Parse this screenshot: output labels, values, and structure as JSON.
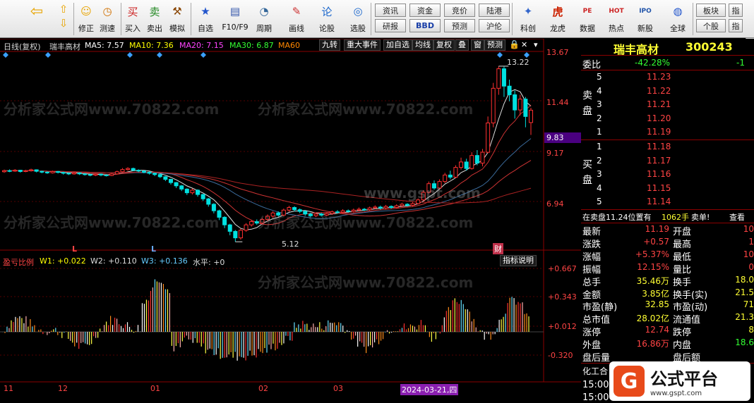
{
  "toolbar": {
    "items": [
      {
        "label": "",
        "icon": "back-arrow-icon"
      },
      {
        "label": "修正",
        "icon": "smile-icon"
      },
      {
        "label": "测速",
        "icon": "clock-icon"
      },
      {
        "label": "买入",
        "icon": "buy-icon"
      },
      {
        "label": "卖出",
        "icon": "sell-icon"
      },
      {
        "label": "模拟",
        "icon": "hammer-icon"
      },
      {
        "label": "自选",
        "icon": "star-icon"
      },
      {
        "label": "F10/F9",
        "icon": "window-icon"
      },
      {
        "label": "周期",
        "icon": "cycle-icon"
      },
      {
        "label": "画线",
        "icon": "pencil-icon"
      },
      {
        "label": "论股",
        "icon": "chat-icon"
      },
      {
        "label": "选股",
        "icon": "chart-search-icon"
      }
    ],
    "grid_buttons": [
      [
        "资讯",
        "资金",
        "竞价",
        "陆港"
      ],
      [
        "研报",
        "BBD",
        "预测",
        "沪伦"
      ]
    ],
    "right_items": [
      {
        "label": "科创",
        "icon": "science-icon"
      },
      {
        "label": "龙虎",
        "icon": "tiger-icon"
      },
      {
        "label": "数据",
        "icon": "pe-icon"
      },
      {
        "label": "热点",
        "icon": "hot-icon"
      },
      {
        "label": "新股",
        "icon": "ipo-icon"
      },
      {
        "label": "全球",
        "icon": "globe-icon"
      }
    ],
    "far_right": [
      [
        "板块",
        "个股"
      ],
      [
        "指",
        "指"
      ]
    ]
  },
  "chart_header": {
    "period": "日线(复权)",
    "name": "瑞丰高材",
    "ma5": "MA5: 7.57",
    "ma10": "MA10: 7.36",
    "ma20": "MA20: 7.15",
    "ma30": "MA30: 6.87",
    "ma60": "MA60",
    "buttons": [
      "九转",
      "重大事件",
      "加自选",
      "均线",
      "复权",
      "叠",
      "窗",
      "预测"
    ]
  },
  "price_axis": [
    "13.67",
    "11.44",
    "9.83",
    "9.17",
    "6.94"
  ],
  "annotations": {
    "high": "13.22",
    "low": "5.12",
    "event_tag": "财"
  },
  "l_markers": [
    "L",
    "L"
  ],
  "indicator": {
    "name": "盈亏比例",
    "w1": "W1: +0.022",
    "w2": "W2: +0.110",
    "w3": "W3: +0.136",
    "level": "水平: +0",
    "button": "指标说明",
    "axis": [
      "+0.667",
      "+0.343",
      "+0.012",
      "-0.320"
    ]
  },
  "date_axis": [
    "11",
    "12",
    "01",
    "02",
    "03"
  ],
  "date_highlight": "2024-03-21,四",
  "watermark": "分析家公式网www.70822.com",
  "watermark_center": "www.gspt.com",
  "quote": {
    "title": "瑞丰高材",
    "code": "300243",
    "weibi_label": "委比",
    "weibi_value": "-42.28%",
    "weibi_extra": "-1",
    "sell_label": "卖盘",
    "buy_label": "买盘",
    "sell": [
      {
        "lvl": "5",
        "price": "11.23"
      },
      {
        "lvl": "4",
        "price": "11.22"
      },
      {
        "lvl": "3",
        "price": "11.21"
      },
      {
        "lvl": "2",
        "price": "11.20"
      },
      {
        "lvl": "1",
        "price": "11.19"
      }
    ],
    "buy": [
      {
        "lvl": "1",
        "price": "11.18"
      },
      {
        "lvl": "2",
        "price": "11.17"
      },
      {
        "lvl": "3",
        "price": "11.16"
      },
      {
        "lvl": "4",
        "price": "11.15"
      },
      {
        "lvl": "5",
        "price": "11.14"
      }
    ],
    "info_line": {
      "text": "在卖盘11.24位置有",
      "vol": "1062手",
      "tag": "卖单!",
      "link": "查看"
    },
    "stats": [
      {
        "l": "最新",
        "v": "11.19",
        "l2": "开盘",
        "v2": "10"
      },
      {
        "l": "涨跌",
        "v": "+0.57",
        "l2": "最高",
        "v2": "1"
      },
      {
        "l": "涨幅",
        "v": "+5.37%",
        "l2": "最低",
        "v2": "10"
      },
      {
        "l": "振幅",
        "v": "12.15%",
        "l2": "量比",
        "v2": "0"
      },
      {
        "l": "总手",
        "v": "35.46万",
        "l2": "换手",
        "v2": "18.0"
      },
      {
        "l": "金额",
        "v": "3.85亿",
        "l2": "换手(实)",
        "v2": "21.5"
      },
      {
        "l": "市盈(静)",
        "v": "32.85",
        "l2": "市盈(动)",
        "v2": "71"
      },
      {
        "l": "总市值",
        "v": "28.02亿",
        "l2": "流通值",
        "v2": "21.3"
      },
      {
        "l": "涨停",
        "v": "12.74",
        "l2": "跌停",
        "v2": "8"
      },
      {
        "l": "外盘",
        "v": "16.86万",
        "l2": "内盘",
        "v2": "18.6"
      },
      {
        "l": "盘后量",
        "v": "",
        "l2": "盘后额",
        "v2": ""
      }
    ],
    "bottom1": "化工合",
    "bottom2": "15:00",
    "bottom3": "15:00"
  },
  "logo": {
    "text": "公式平台",
    "url": "www.gspt.com"
  },
  "chart_data": {
    "type": "candlestick",
    "price_range": [
      4.8,
      13.9
    ],
    "candles": [
      [
        8.35,
        8.4,
        8.45,
        8.3
      ],
      [
        8.4,
        8.38,
        8.46,
        8.33
      ],
      [
        8.38,
        8.42,
        8.47,
        8.34
      ],
      [
        8.42,
        8.36,
        8.44,
        8.31
      ],
      [
        8.36,
        8.4,
        8.44,
        8.33
      ],
      [
        8.4,
        8.44,
        8.49,
        8.36
      ],
      [
        8.44,
        8.37,
        8.46,
        8.32
      ],
      [
        8.37,
        8.33,
        8.4,
        8.28
      ],
      [
        8.33,
        8.3,
        8.37,
        8.25
      ],
      [
        8.3,
        8.36,
        8.4,
        8.27
      ],
      [
        8.36,
        8.32,
        8.39,
        8.27
      ],
      [
        8.32,
        8.28,
        8.35,
        8.22
      ],
      [
        8.28,
        8.25,
        8.31,
        8.2
      ],
      [
        8.25,
        8.3,
        8.33,
        8.21
      ],
      [
        8.3,
        8.25,
        8.33,
        8.2
      ],
      [
        8.25,
        8.22,
        8.29,
        8.17
      ],
      [
        8.22,
        8.19,
        8.26,
        8.14
      ],
      [
        8.19,
        8.24,
        8.28,
        8.15
      ],
      [
        8.24,
        8.2,
        8.27,
        8.14
      ],
      [
        8.2,
        8.18,
        8.24,
        8.13
      ],
      [
        8.18,
        8.25,
        8.29,
        8.15
      ],
      [
        8.25,
        8.35,
        8.4,
        8.22
      ],
      [
        8.35,
        8.45,
        8.52,
        8.32
      ],
      [
        8.45,
        8.5,
        8.56,
        8.4
      ],
      [
        8.5,
        8.42,
        8.54,
        8.38
      ],
      [
        8.42,
        8.38,
        8.46,
        8.33
      ],
      [
        8.38,
        8.33,
        8.41,
        8.28
      ],
      [
        8.33,
        8.28,
        8.36,
        8.22
      ],
      [
        8.28,
        8.22,
        8.31,
        8.15
      ],
      [
        8.22,
        8.12,
        8.25,
        8.06
      ],
      [
        8.12,
        8.0,
        8.15,
        7.92
      ],
      [
        8.0,
        7.85,
        8.03,
        7.76
      ],
      [
        7.85,
        7.7,
        7.88,
        7.6
      ],
      [
        7.7,
        7.55,
        7.74,
        7.46
      ],
      [
        7.55,
        7.38,
        7.59,
        7.28
      ],
      [
        7.38,
        7.5,
        7.58,
        7.3
      ],
      [
        7.5,
        7.3,
        7.54,
        7.2
      ],
      [
        7.3,
        7.1,
        7.33,
        7.0
      ],
      [
        7.1,
        6.85,
        7.14,
        6.74
      ],
      [
        6.85,
        6.55,
        6.9,
        6.43
      ],
      [
        6.55,
        6.25,
        6.6,
        6.12
      ],
      [
        6.25,
        5.9,
        6.3,
        5.75
      ],
      [
        5.9,
        5.6,
        5.95,
        5.42
      ],
      [
        5.6,
        5.3,
        5.66,
        5.12
      ],
      [
        5.3,
        5.65,
        5.72,
        5.22
      ],
      [
        5.65,
        5.9,
        5.98,
        5.58
      ],
      [
        5.9,
        6.05,
        6.12,
        5.82
      ],
      [
        6.05,
        5.98,
        6.15,
        5.9
      ],
      [
        5.98,
        6.15,
        6.22,
        5.92
      ],
      [
        6.15,
        6.3,
        6.38,
        6.08
      ],
      [
        6.3,
        6.45,
        6.53,
        6.22
      ],
      [
        6.45,
        6.35,
        6.52,
        6.28
      ],
      [
        6.35,
        6.58,
        6.65,
        6.3
      ],
      [
        6.58,
        6.7,
        6.78,
        6.5
      ],
      [
        6.7,
        6.6,
        6.76,
        6.52
      ],
      [
        6.6,
        6.52,
        6.66,
        6.44
      ],
      [
        6.52,
        6.4,
        6.58,
        6.32
      ],
      [
        6.4,
        6.32,
        6.46,
        6.25
      ],
      [
        6.32,
        6.4,
        6.47,
        6.26
      ],
      [
        6.4,
        6.35,
        6.46,
        6.28
      ],
      [
        6.35,
        6.42,
        6.48,
        6.3
      ],
      [
        6.42,
        6.5,
        6.56,
        6.36
      ],
      [
        6.5,
        6.48,
        6.58,
        6.42
      ],
      [
        6.48,
        6.55,
        6.62,
        6.43
      ],
      [
        6.55,
        6.52,
        6.61,
        6.46
      ],
      [
        6.52,
        6.58,
        6.65,
        6.47
      ],
      [
        6.58,
        6.62,
        6.7,
        6.52
      ],
      [
        6.62,
        6.6,
        6.68,
        6.54
      ],
      [
        6.6,
        6.68,
        6.74,
        6.55
      ],
      [
        6.68,
        6.72,
        6.8,
        6.62
      ],
      [
        6.72,
        6.68,
        6.79,
        6.6
      ],
      [
        6.68,
        6.75,
        6.82,
        6.62
      ],
      [
        6.75,
        6.7,
        6.8,
        6.64
      ],
      [
        6.7,
        6.78,
        6.85,
        6.66
      ],
      [
        6.78,
        6.85,
        6.92,
        6.72
      ],
      [
        6.85,
        6.8,
        6.9,
        6.74
      ],
      [
        6.8,
        6.88,
        6.95,
        6.75
      ],
      [
        6.88,
        7.05,
        7.12,
        6.84
      ],
      [
        7.05,
        7.4,
        7.5,
        7.0
      ],
      [
        7.4,
        7.8,
        7.9,
        7.35
      ],
      [
        7.8,
        7.6,
        7.95,
        7.52
      ],
      [
        7.6,
        7.9,
        8.0,
        7.55
      ],
      [
        7.9,
        8.2,
        8.3,
        7.82
      ],
      [
        8.2,
        8.1,
        8.4,
        8.0
      ],
      [
        8.1,
        8.55,
        8.65,
        8.05
      ],
      [
        8.55,
        8.8,
        9.0,
        8.45
      ],
      [
        8.8,
        8.5,
        8.95,
        8.4
      ],
      [
        8.5,
        9.1,
        9.25,
        8.45
      ],
      [
        9.1,
        8.75,
        9.35,
        8.65
      ],
      [
        8.75,
        9.25,
        9.4,
        8.6
      ],
      [
        9.25,
        10.6,
        10.9,
        9.2
      ],
      [
        10.6,
        12.2,
        12.45,
        10.4
      ],
      [
        12.2,
        13.1,
        13.22,
        11.9
      ],
      [
        13.1,
        12.3,
        13.2,
        11.8
      ],
      [
        12.3,
        11.9,
        12.6,
        11.6
      ],
      [
        11.9,
        11.2,
        12.1,
        10.8
      ],
      [
        11.2,
        11.7,
        11.9,
        10.95
      ],
      [
        11.7,
        10.9,
        11.8,
        10.4
      ],
      [
        10.62,
        11.19,
        11.3,
        10.05
      ]
    ],
    "ma_colors": [
      "#ffffff",
      "#ffff00",
      "#ff44ff",
      "#33ff33",
      "#ff8800"
    ],
    "indicator_range": [
      -0.5,
      0.75
    ]
  }
}
